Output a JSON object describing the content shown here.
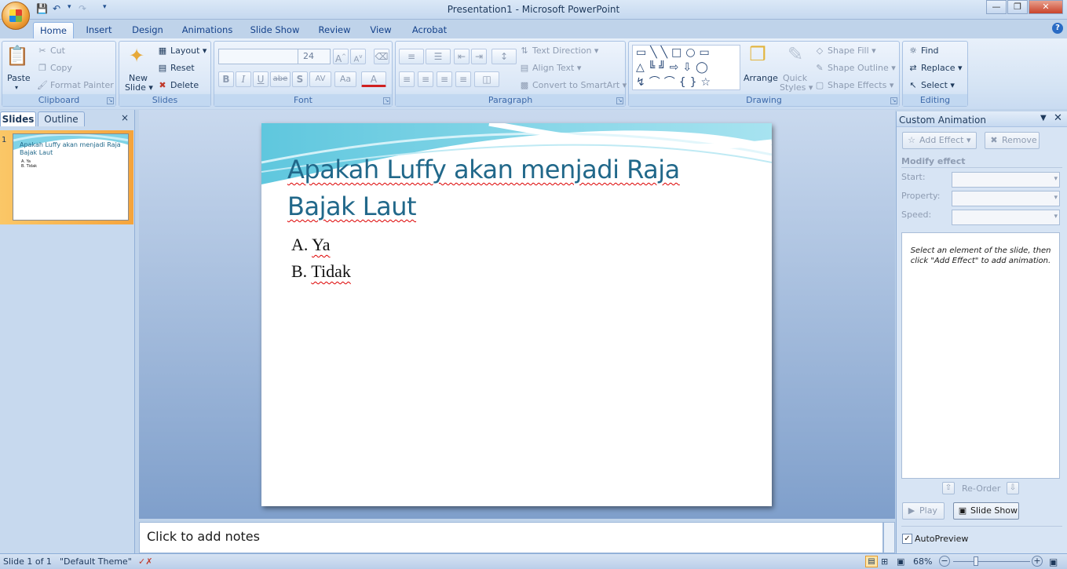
{
  "window": {
    "title": "Presentation1 - Microsoft PowerPoint"
  },
  "tabs": [
    "Home",
    "Insert",
    "Design",
    "Animations",
    "Slide Show",
    "Review",
    "View",
    "Acrobat"
  ],
  "ribbon": {
    "clipboard": {
      "label": "Clipboard",
      "paste": "Paste",
      "cut": "Cut",
      "copy": "Copy",
      "format_painter": "Format Painter"
    },
    "slides": {
      "label": "Slides",
      "new_slide_1": "New",
      "new_slide_2": "Slide",
      "layout": "Layout",
      "reset": "Reset",
      "delete": "Delete"
    },
    "font": {
      "label": "Font",
      "font_name": "",
      "font_size": "24",
      "bold": "B",
      "italic": "I",
      "underline": "U",
      "strike": "abe",
      "shadow": "S",
      "spacing": "AV",
      "case": "Aa",
      "color": "A",
      "grow": "A",
      "shrink": "A"
    },
    "paragraph": {
      "label": "Paragraph",
      "text_direction": "Text Direction",
      "align_text": "Align Text",
      "smartart": "Convert to SmartArt"
    },
    "drawing": {
      "label": "Drawing",
      "arrange": "Arrange",
      "quick_styles_1": "Quick",
      "quick_styles_2": "Styles",
      "shape_fill": "Shape Fill",
      "shape_outline": "Shape Outline",
      "shape_effects": "Shape Effects"
    },
    "editing": {
      "label": "Editing",
      "find": "Find",
      "replace": "Replace",
      "select": "Select"
    }
  },
  "slides_pane": {
    "tab_slides": "Slides",
    "tab_outline": "Outline",
    "slide_number": "1",
    "thumb_title": "Apakah Luffy akan menjadi Raja Bajak Laut",
    "thumb_a": "A. Ya",
    "thumb_b": "B. Tidak"
  },
  "slide": {
    "title_line1": "Apakah Luffy akan menjadi Raja",
    "title_line2": "Bajak Laut",
    "bullets": [
      {
        "marker": "A.",
        "text": "Ya"
      },
      {
        "marker": "B.",
        "text": "Tidak"
      }
    ]
  },
  "notes": {
    "placeholder": "Click to add notes"
  },
  "custom_animation": {
    "title": "Custom Animation",
    "add_effect": "Add Effect",
    "remove": "Remove",
    "modify_effect": "Modify effect",
    "start": "Start:",
    "property": "Property:",
    "speed": "Speed:",
    "hint": "Select an element of the slide, then click \"Add Effect\" to add animation.",
    "reorder": "Re-Order",
    "play": "Play",
    "slide_show": "Slide Show",
    "autopreview": "AutoPreview",
    "autopreview_checked": true
  },
  "status": {
    "slide_info": "Slide 1 of 1",
    "theme": "\"Default Theme\"",
    "zoom": "68%"
  },
  "colors": {
    "title_text": "#21688a",
    "accent": "#15428b"
  }
}
